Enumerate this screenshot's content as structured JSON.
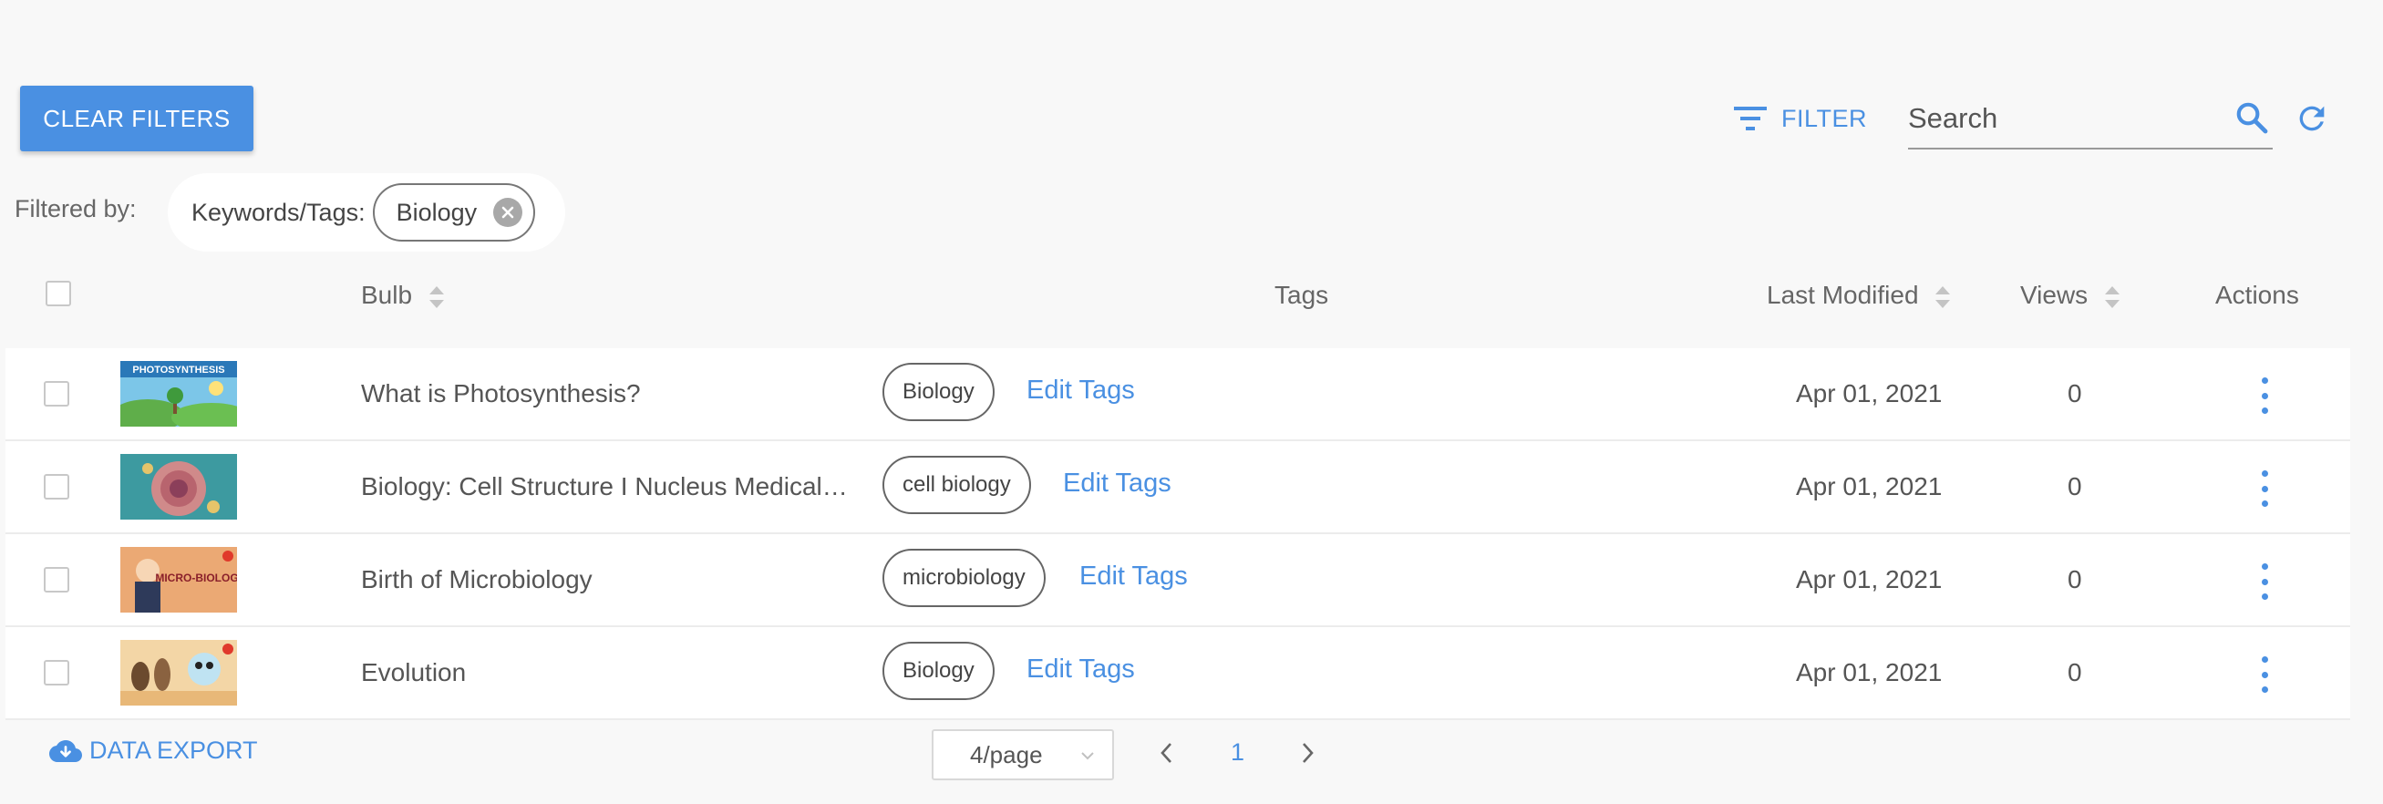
{
  "toolbar": {
    "clear_filters_label": "CLEAR FILTERS",
    "filter_label": "FILTER",
    "search_placeholder": "Search"
  },
  "filters": {
    "filtered_by_label": "Filtered by:",
    "category_label": "Keywords/Tags:",
    "chip_value": "Biology"
  },
  "table": {
    "headers": {
      "bulb": "Bulb",
      "tags": "Tags",
      "last_modified": "Last Modified",
      "views": "Views",
      "actions": "Actions"
    },
    "edit_tags_label": "Edit Tags",
    "rows": [
      {
        "title": "What is Photosynthesis?",
        "thumb_label": "PHOTOSYNTHESIS",
        "tag": "Biology",
        "date": "Apr 01, 2021",
        "views": "0"
      },
      {
        "title": "Biology: Cell Structure I Nucleus Medical…",
        "thumb_label": "",
        "tag": "cell biology",
        "date": "Apr 01, 2021",
        "views": "0"
      },
      {
        "title": "Birth of Microbiology",
        "thumb_label": "MICRO-BIOLOGY",
        "tag": "microbiology",
        "date": "Apr 01, 2021",
        "views": "0"
      },
      {
        "title": "Evolution",
        "thumb_label": "",
        "tag": "Biology",
        "date": "Apr 01, 2021",
        "views": "0"
      }
    ]
  },
  "footer": {
    "export_label": "DATA EXPORT",
    "page_size": "4/page",
    "current_page": "1"
  },
  "colors": {
    "accent": "#4a90e2",
    "background": "#f8f8f8"
  }
}
